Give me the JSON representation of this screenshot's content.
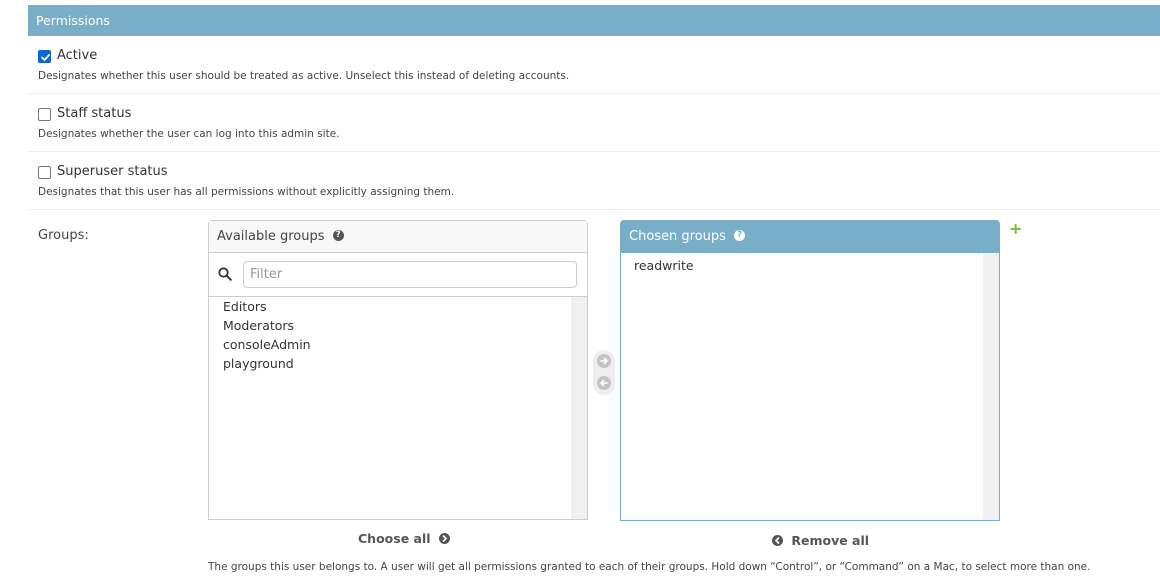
{
  "fieldset": {
    "title": "Permissions"
  },
  "active": {
    "label": "Active",
    "checked": true,
    "help": "Designates whether this user should be treated as active. Unselect this instead of deleting accounts."
  },
  "staff": {
    "label": "Staff status",
    "checked": false,
    "help": "Designates whether the user can log into this admin site."
  },
  "superuser": {
    "label": "Superuser status",
    "checked": false,
    "help": "Designates that this user has all permissions without explicitly assigning them."
  },
  "groups": {
    "label": "Groups:",
    "available_title": "Available groups",
    "filter_placeholder": "Filter",
    "available": [
      "Editors",
      "Moderators",
      "consoleAdmin",
      "playground"
    ],
    "chosen_title": "Chosen groups",
    "chosen": [
      "readwrite"
    ],
    "choose_all": "Choose all",
    "remove_all": "Remove all",
    "help": "The groups this user belongs to. A user will get all permissions granted to each of their groups. Hold down “Control”, or “Command” on a Mac, to select more than one.",
    "icons": {
      "help": "question-circle-icon",
      "search": "search-icon",
      "add": "plus-icon",
      "move_right": "arrow-right-circle-icon",
      "move_left": "arrow-left-circle-icon"
    }
  },
  "colors": {
    "header_bg": "#79aec8",
    "checkbox_checked": "#0a66d8",
    "add_green": "#70bf2b"
  }
}
